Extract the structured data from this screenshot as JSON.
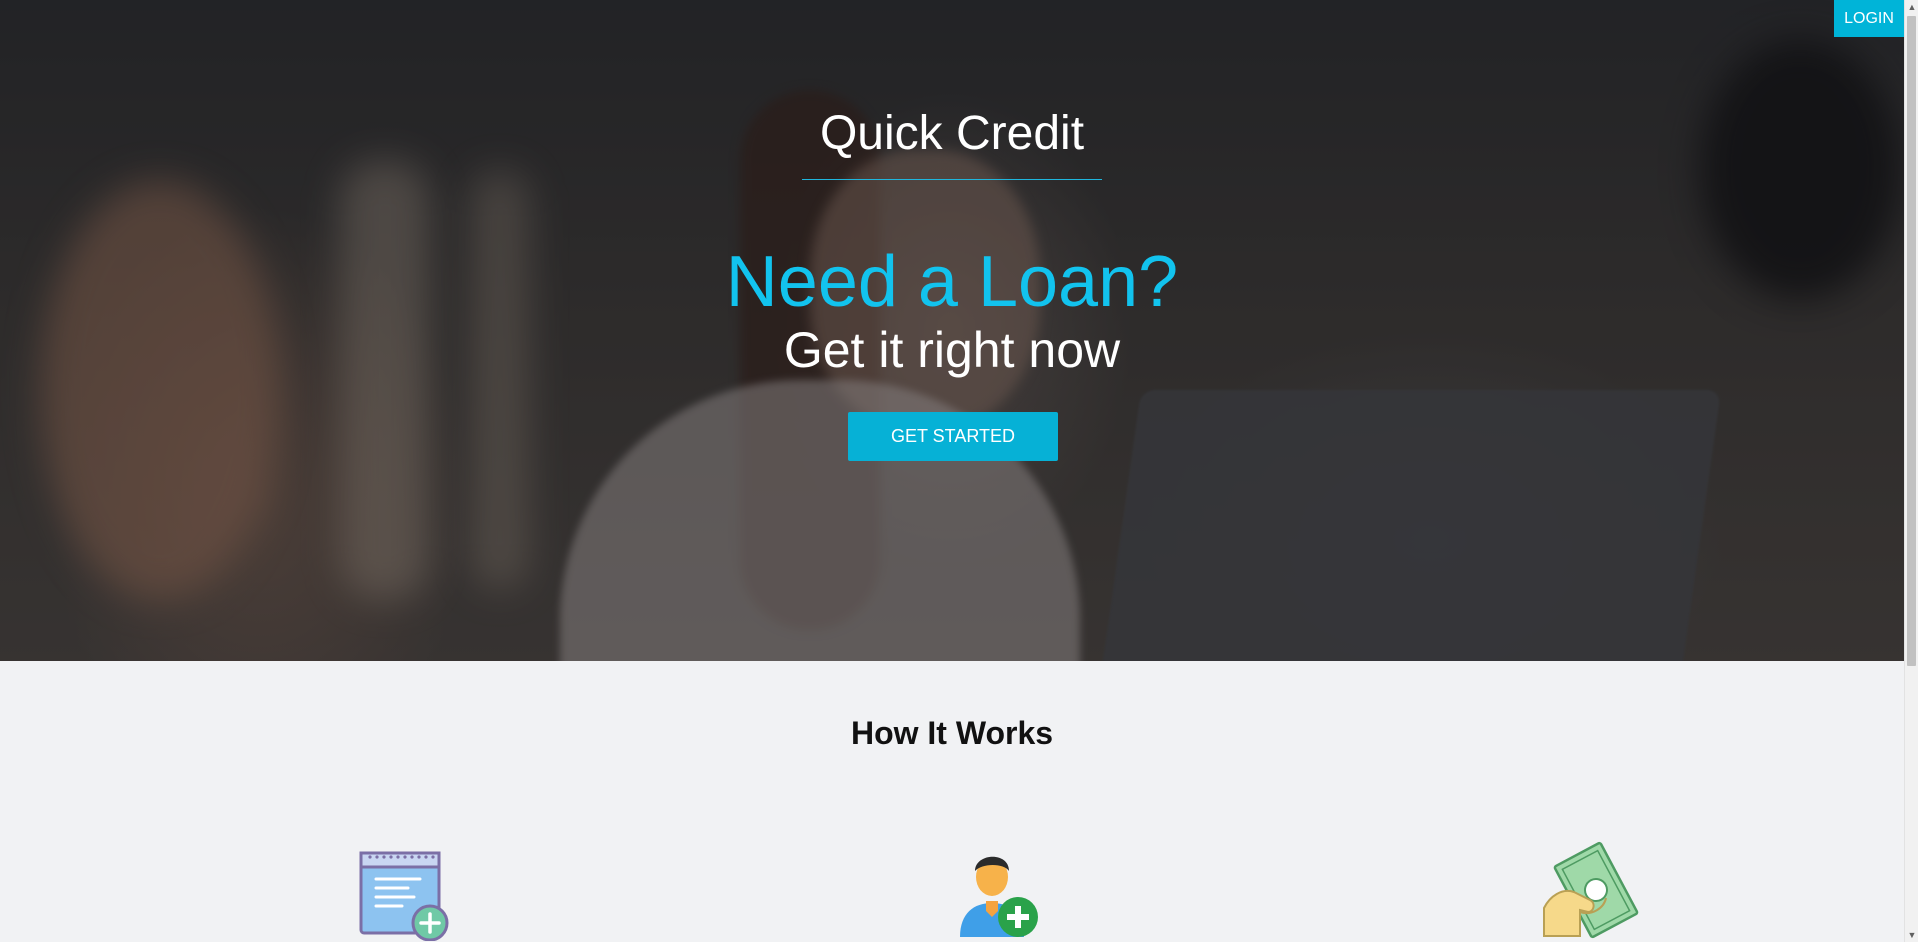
{
  "header": {
    "login_label": "LOGIN"
  },
  "hero": {
    "brand": "Quick Credit",
    "headline": "Need a Loan?",
    "subheadline": "Get it right now",
    "cta_label": "GET STARTED"
  },
  "how_it_works": {
    "title": "How It Works",
    "steps": [
      {
        "icon": "application-form-icon"
      },
      {
        "icon": "add-user-icon"
      },
      {
        "icon": "cash-in-hand-icon"
      }
    ]
  },
  "colors": {
    "accent": "#00b4d8",
    "headline": "#12c3ee",
    "section_background": "#f1f2f4"
  }
}
